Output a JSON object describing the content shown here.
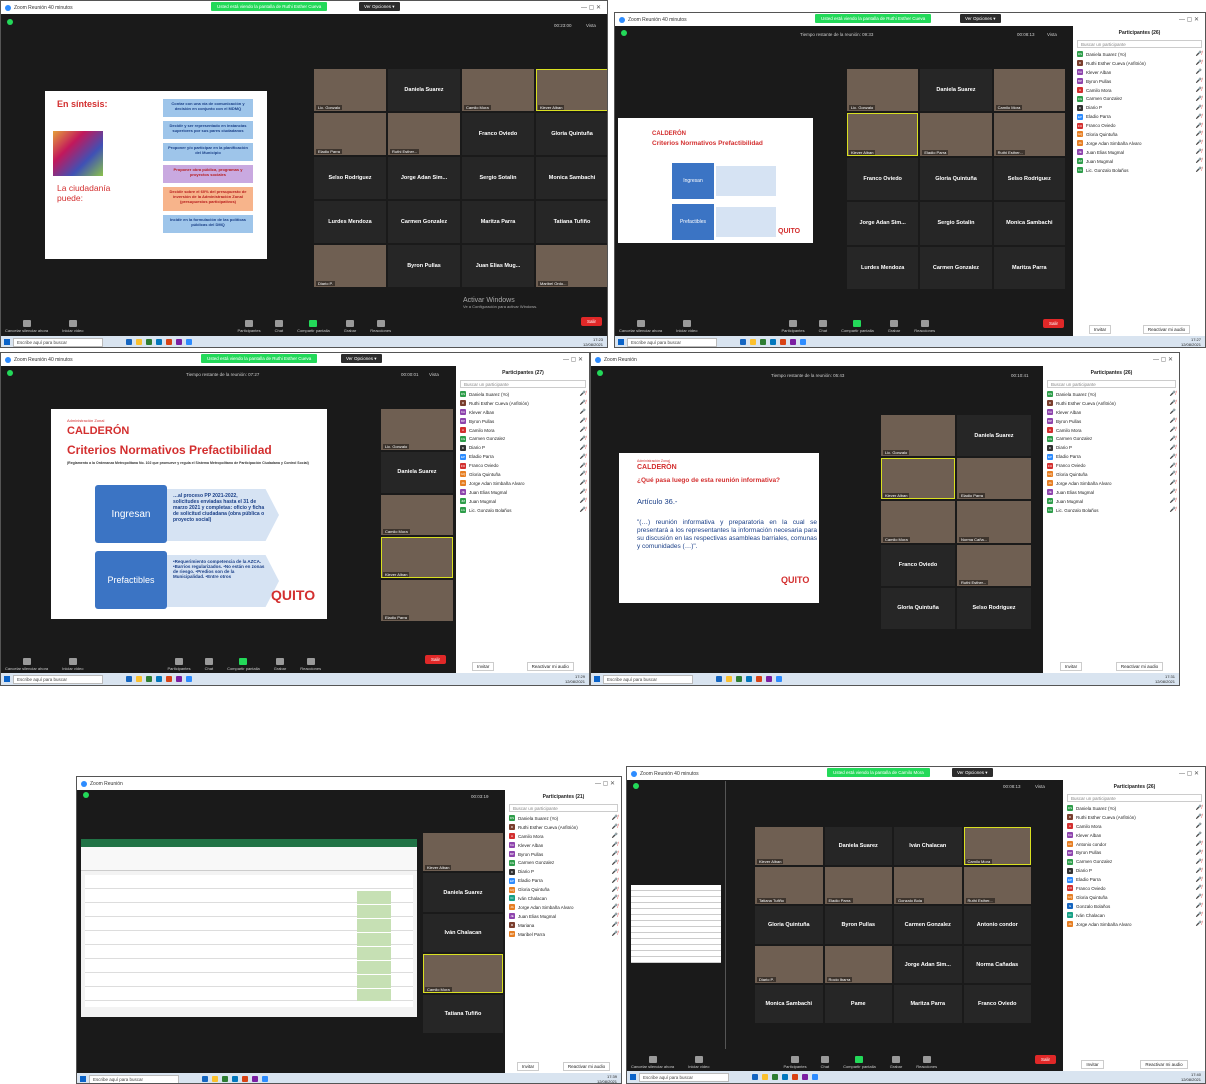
{
  "common": {
    "search_taskbar": "Escribe aquí para buscar",
    "titulo_zoom": "Zoom Reunión 40 minutos",
    "titulo_zoom_b": "Zoom Reunión",
    "compartir": "Compartir pantalla",
    "salir": "Salir",
    "buscar": "Buscar un participante",
    "invitar": "Invitar",
    "reactivar": "Reactivar mi audio",
    "activar": "Activar Windows",
    "activar_sub": "Ve a Configuración para activar Windows.",
    "ver_opciones": "Ver Opciones ▾",
    "vista": "Vista",
    "ctrl": [
      "Cancelar silenciar ahora",
      "Iniciar video",
      "Participantes",
      "Chat",
      "Compartir pantalla",
      "Grabar",
      "Reacciones"
    ],
    "lang": "ESP",
    "date": "12/08/2021"
  },
  "s1": {
    "banner": "Usted está viendo la pantalla de Ruthi Esther Cueva",
    "timer": "00:23:00",
    "slide_title": "En síntesis:",
    "ciudadania": "La ciudadanía puede:",
    "boxes": [
      "Contar con una vía de comunicación y decisión en conjunto con el MDMQ",
      "Decidir y ser representado en instancias superiores por sus pares ciudadanos",
      "Proponer y/o participar en la planificación del Municipio",
      "Proponer obra pública, programas y proyectos sociales",
      "Decidir sobre el 60% del presupuesto de inversión de la Administración Zonal (presupuestos participativos)",
      "Incidir en la formulación de las políticas públicas del DMQ"
    ],
    "tiles": [
      "Lic. Gonzalo",
      "Daniela Suarez",
      "Camilo Mora",
      "Klever Alban",
      "Eladio Parra",
      "Ruthi Esther...",
      "Franco Oviedo",
      "Gloria Quintuña",
      "Selso Rodriguez",
      "Jorge Adan Sim...",
      "Sergio Sotalin",
      "Monica Sambachi",
      "Lurdes Mendoza",
      "Carmen Gonzalez",
      "Maritza Parra",
      "Tatiana Tufiño",
      "Diario P.",
      "Byron Pullas",
      "Juan Elias Mug...",
      "Maribel Ordo..."
    ],
    "count": "25",
    "time": "17:23"
  },
  "s2": {
    "banner": "Usted está viendo la pantalla de Ruthi Esther Cueva",
    "remaining": "Tiempo restante de la reunión: 09:33",
    "timer": "00:08:13",
    "admin": "Administración Zonal",
    "calderon": "CALDERÓN",
    "title": "Criterios Normativos Prefactibilidad",
    "ingresan": "Ingresan",
    "prefactibles": "Prefactibles",
    "quito": "QUITO",
    "participants": "Participantes (26)",
    "count": "26",
    "tiles": [
      "Lic. Gonzalo",
      "Daniela Suarez",
      "Camilo Mora",
      "Klever Alban",
      "Eladio Parra",
      "Ruthi Esther...",
      "Franco Oviedo",
      "Gloria Quintuña",
      "Selso Rodriguez",
      "Jorge Adan Sim...",
      "Sergio Sotalin",
      "Monica Sambachi",
      "Lurdes Mendoza",
      "Carmen Gonzalez",
      "Maritza Parra"
    ],
    "people": [
      "Daniela Suarez (Yo)",
      "Ruthi Esther Cueva (Anfitrión)",
      "Klever Alban",
      "Byron Pullas",
      "Camilo Mora",
      "Carmen Gonzalez",
      "Diario P",
      "Eladio Parra",
      "Franco Oviedo",
      "Gloria Quintuña",
      "Jorge Adan Simbaña Alvaro",
      "Juan Elias Mugmal",
      "Juan Mugmal",
      "Lic. Gonzalo Bolaños"
    ],
    "time": "17:27"
  },
  "s3": {
    "banner": "Usted está viendo la pantalla de Ruthi Esther Cueva",
    "remaining": "Tiempo restante de la reunión: 07:27",
    "timer": "00:00:01",
    "admin": "Administración Zonal",
    "calderon": "CALDERÓN",
    "title": "Criterios Normativos Prefactibilidad",
    "subtitle": "(Reglamento a la Ordenanza Metropolitana No. 102 que promueve y regula el Sistema Metropolitano de Participación Ciudadana y Control Social)",
    "ingresan": "Ingresan",
    "ingresan_text": "…al proceso PP 2021-2022, solicitudes enviadas hasta el 31 de marzo 2021 y completas: oficio y ficha de solicitud ciudadana (obra pública o proyecto social)",
    "prefactibles": "Prefactibles",
    "pref_text": "•Requerimiento competencia de la AZCA. •Barrios regularizados. •No están en zonas de riesgo. •Predios son de la Municipalidad. •Entre otros",
    "quito": "QUITO",
    "participants": "Participantes (27)",
    "count": "27",
    "tiles": [
      "Lic. Gonzalo",
      "Daniela Suarez",
      "Camilo Mora",
      "Klever Alban",
      "Eladio Parra"
    ],
    "people": [
      "Daniela Suarez (Yo)",
      "Ruthi Esther Cueva (Anfitrión)",
      "Klever Alban",
      "Byron Pullas",
      "Camilo Mora",
      "Carmen Gonzalez",
      "Diario P",
      "Eladio Parra",
      "Franco Oviedo",
      "Gloria Quintuña",
      "Jorge Adan Simbaña Alvaro",
      "Juan Elias Mugmal",
      "Juan Mugmal",
      "Lic. Gonzalo Bolaños"
    ],
    "time": "17:29"
  },
  "s4": {
    "remaining": "Tiempo restante de la reunión: 05:43",
    "timer": "00:10:41",
    "admin": "Administración Zonal",
    "calderon": "CALDERÓN",
    "question": "¿Qué pasa luego de esta reunión informativa?",
    "articulo": "Artículo 36.-",
    "quote": "\"(…) reunión informativa y preparatoria en la cual se presentará a los representantes la información necesaria para su discusión en las respectivas asambleas barriales, comunas y comunidades (…)\".",
    "quito": "QUITO",
    "participants": "Participantes (26)",
    "tiles": [
      "Lic. Gonzalo",
      "Daniela Suarez",
      "Klever Alban",
      "Eladio Parra",
      "Camilo Mora",
      "Norma Caña...",
      "Franco Oviedo",
      "Ruthi Esther...",
      "Gloria Quintuña",
      "Selso Rodriguez"
    ],
    "people": [
      "Daniela Suarez (Yo)",
      "Ruthi Esther Cueva (Anfitrión)",
      "Klever Alban",
      "Byron Pullas",
      "Camilo Mora",
      "Carmen Gonzalez",
      "Diario P",
      "Eladio Parra",
      "Franco Oviedo",
      "Gloria Quintuña",
      "Jorge Adan Simbaña Alvaro",
      "Juan Elias Mugmal",
      "Juan Mugmal",
      "Lic. Gonzalo Bolaños"
    ],
    "time": "17:31"
  },
  "s5": {
    "timer": "00:03:19",
    "participants": "Participantes (21)",
    "tiles": [
      "Klever Alban",
      "Daniela Suarez",
      "Iván Chalacan",
      "Camilo Mora",
      "Tatiana Tufiño"
    ],
    "people": [
      "Daniela Suarez (Yo)",
      "Ruthi Esther Cueva (Anfitrión)",
      "Camilo Mora",
      "Klever Alban",
      "Byron Pullas",
      "Carmen Gonzalez",
      "Diario P",
      "Eladio Parra",
      "Gloria Quintuña",
      "Iván Chalacan",
      "Jorge Adan Simbaña Alvaro",
      "Juan Elias Mugmal",
      "Mariana",
      "Maribel Parra"
    ],
    "time": "17:39"
  },
  "s6": {
    "banner": "Usted está viendo la pantalla de Camilo Mora",
    "timer": "00:08:13",
    "participants": "Participantes (26)",
    "count": "26",
    "tiles": [
      "Klever Alban",
      "Daniela Suarez",
      "Iván Chalacan",
      "Camilo Mora",
      "Tatiana Tufiño",
      "Eladio Parra",
      "Gonzalo Bola",
      "Ruthi Esther...",
      "Gloria Quintuña",
      "Byron Pullas",
      "Carmen Gonzalez",
      "Antonio condor",
      "Diario P.",
      "Rocio Ibarra",
      "Jorge Adan Sim...",
      "Norma Cañadas",
      "Monica Sambachi",
      "Pame",
      "Maritza Parra",
      "Franco Oviedo"
    ],
    "people": [
      "Daniela Suarez (Yo)",
      "Ruthi Esther Cueva (Anfitrión)",
      "Camilo Mora",
      "Klever Alban",
      "Antonio condor",
      "Byron Pullas",
      "Carmen Gonzalez",
      "Diario P",
      "Eladio Parra",
      "Franco Oviedo",
      "Gloria Quintuña",
      "Gonzalo Bolaños",
      "Iván Chalacan",
      "Jorge Adan Simbaña Alvaro"
    ],
    "time": "17:40"
  }
}
